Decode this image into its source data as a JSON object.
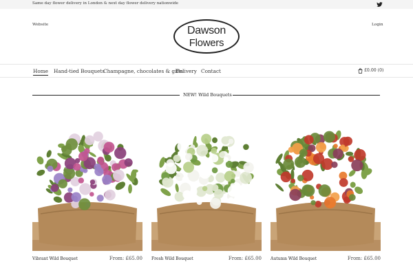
{
  "topbar": {
    "message": "Same day flower delivery in London & next day flower delivery nationwide",
    "social_icon": "twitter-icon"
  },
  "header": {
    "website_link": "Website",
    "login_link": "Login",
    "logo_line1": "Dawson",
    "logo_line2": "Flowers"
  },
  "nav": {
    "items": [
      {
        "label": "Home",
        "active": true
      },
      {
        "label": "Hand-tied Bouquets"
      },
      {
        "label": "Champagne, chocolates & gifts"
      },
      {
        "label": "Delivery"
      },
      {
        "label": "Contact"
      }
    ],
    "cart_label": "£0.00 (0)",
    "cart_icon": "bag-icon"
  },
  "section": {
    "title": "NEW! Wild Bouquets"
  },
  "products": [
    {
      "name": "Vibrant Wild Bouquet",
      "price": "From: £65.00",
      "palette": [
        "#8a3f7a",
        "#c2558f",
        "#9a82c8",
        "#e2d0e0",
        "#6f8f3d"
      ]
    },
    {
      "name": "Fresh Wild Bouquet",
      "price": "From: £65.00",
      "palette": [
        "#f3f3ee",
        "#ffffff",
        "#b7cf8a",
        "#6f9a42",
        "#dfe7cf"
      ]
    },
    {
      "name": "Autumn Wild Bouquet",
      "price": "From: £65.00",
      "palette": [
        "#e8792c",
        "#f3a04a",
        "#c0392b",
        "#6a8a3a",
        "#8a3f5a"
      ]
    }
  ],
  "colors": {
    "text": "#222222",
    "topbar_bg": "#f4f4f4",
    "burlap": "#b48a5a",
    "wood": "#c9a477"
  }
}
